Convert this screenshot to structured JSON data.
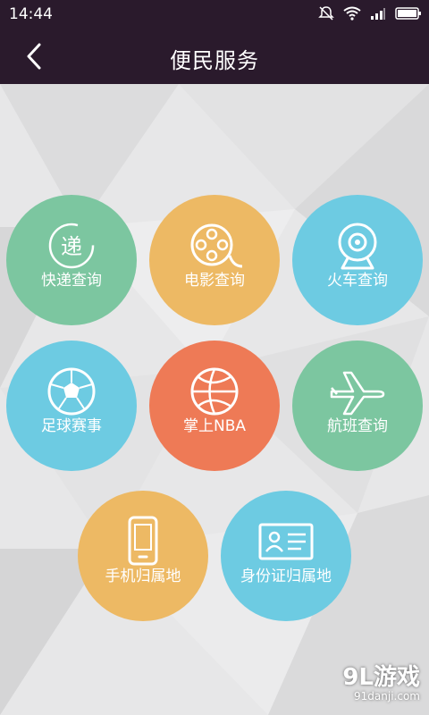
{
  "status": {
    "time": "14:44"
  },
  "header": {
    "title": "便民服务"
  },
  "services": [
    {
      "label": "快递查询"
    },
    {
      "label": "电影查询"
    },
    {
      "label": "火车查询"
    },
    {
      "label": "足球赛事"
    },
    {
      "label": "掌上NBA"
    },
    {
      "label": "航班查询"
    },
    {
      "label": "手机归属地"
    },
    {
      "label": "身份证归属地"
    }
  ],
  "icons": {
    "express": {
      "glyph": "递"
    }
  },
  "watermark": {
    "main": "9L游戏",
    "sub": "91danji.com"
  },
  "colors": {
    "bar": "#2a1a2c",
    "green": "#7cc6a0",
    "yellow": "#edb964",
    "blue": "#6dcbe2",
    "orange": "#ee7a56"
  }
}
